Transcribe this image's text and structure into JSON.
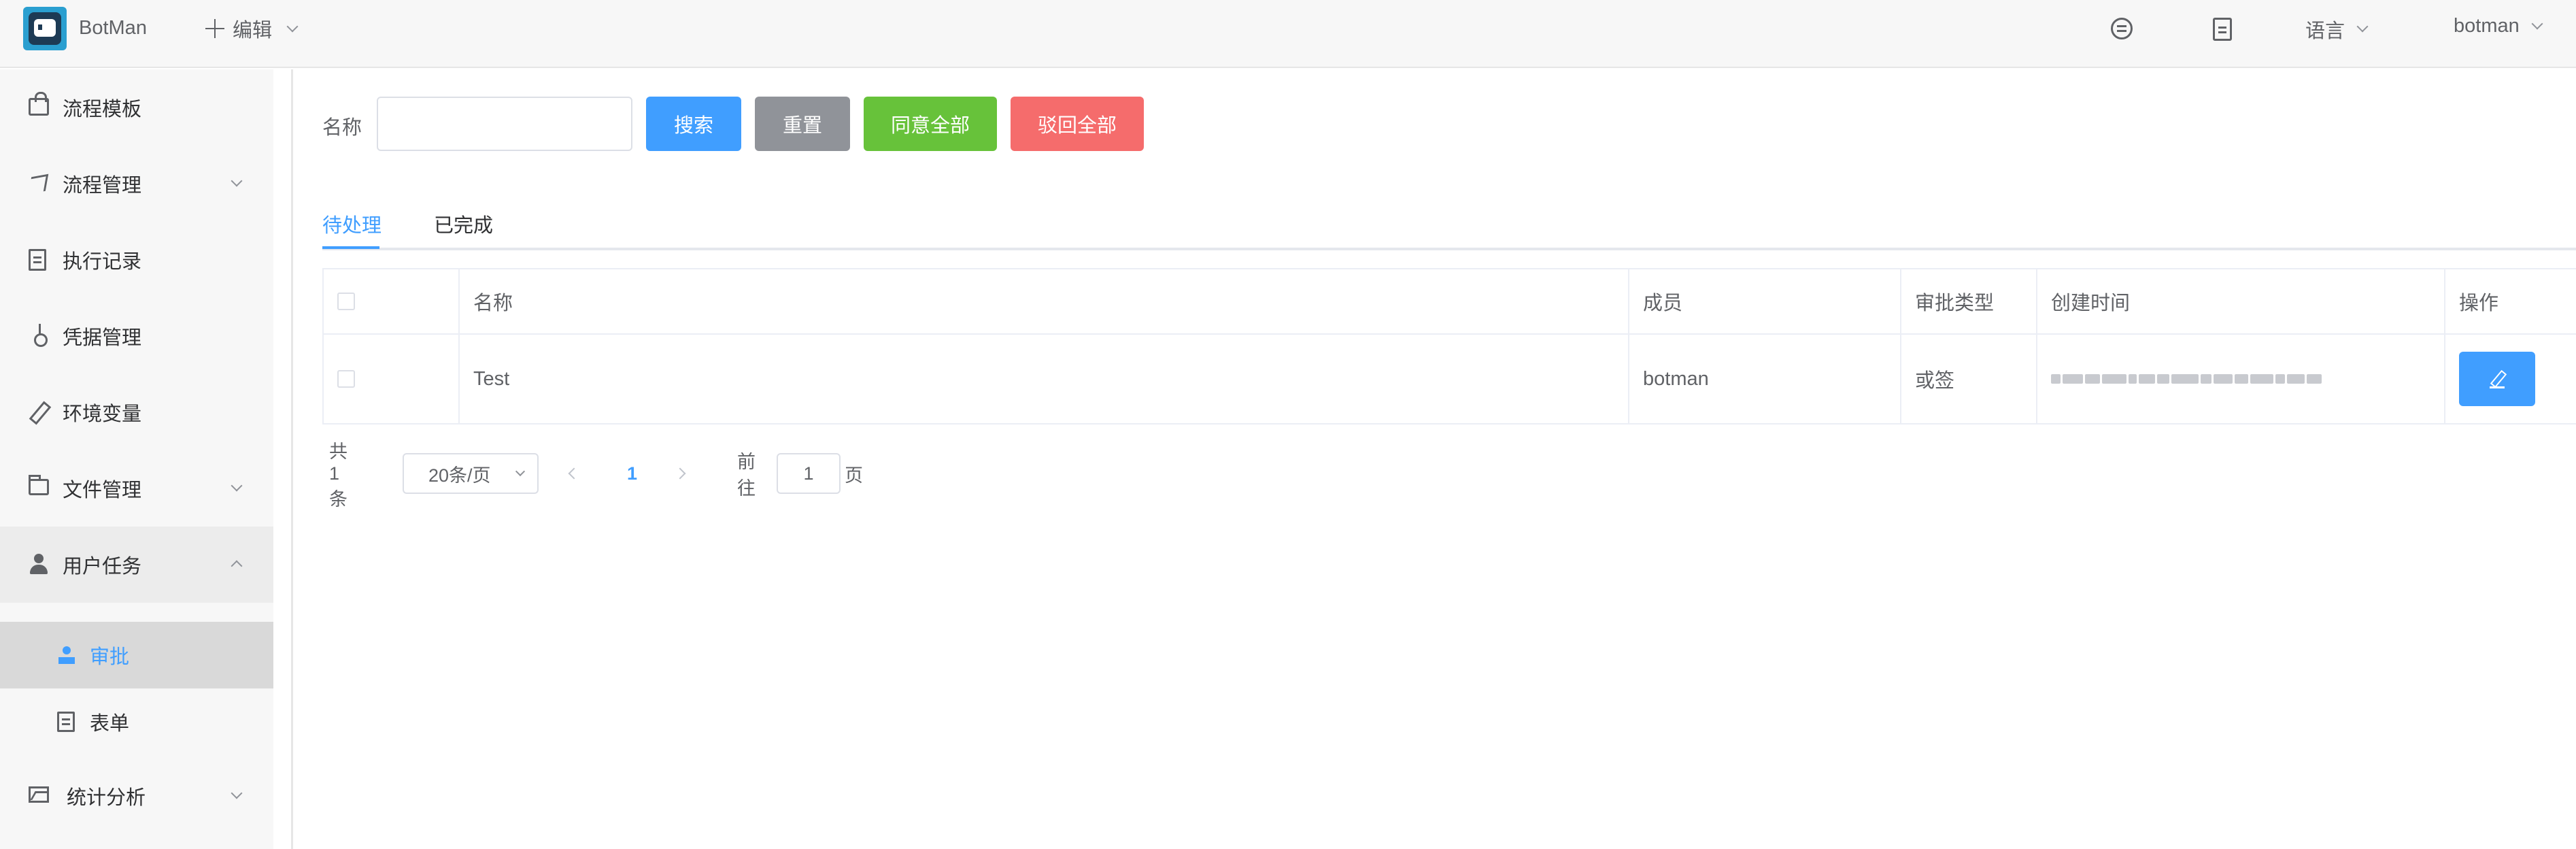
{
  "header": {
    "app_name": "BotMan",
    "edit_menu": "编辑",
    "language_menu": "语言",
    "user_menu": "botman"
  },
  "sidebar": {
    "items": [
      {
        "label": "流程模板",
        "icon": "bag-icon"
      },
      {
        "label": "流程管理",
        "icon": "send-icon",
        "has_children": true
      },
      {
        "label": "执行记录",
        "icon": "list-icon"
      },
      {
        "label": "凭据管理",
        "icon": "key-icon"
      },
      {
        "label": "环境变量",
        "icon": "pen-icon"
      },
      {
        "label": "文件管理",
        "icon": "folder-icon",
        "has_children": true
      },
      {
        "label": "用户任务",
        "icon": "user-icon",
        "expanded": true,
        "children": [
          {
            "label": "审批",
            "icon": "stamp-icon",
            "active": true
          },
          {
            "label": "表单",
            "icon": "form-icon"
          }
        ]
      },
      {
        "label": "统计分析",
        "icon": "chart-icon",
        "has_children": true
      }
    ]
  },
  "filter": {
    "name_label": "名称",
    "name_value": "",
    "search_button": "搜索",
    "reset_button": "重置",
    "approve_all_button": "同意全部",
    "reject_all_button": "驳回全部"
  },
  "tabs": [
    {
      "label": "待处理",
      "active": true
    },
    {
      "label": "已完成",
      "active": false
    }
  ],
  "table": {
    "columns": [
      "名称",
      "成员",
      "审批类型",
      "创建时间",
      "操作"
    ],
    "rows": [
      {
        "name": "Test",
        "member": "botman",
        "type": "或签",
        "created": "(blurred)"
      }
    ]
  },
  "pagination": {
    "total": "共 1 条",
    "page_size": "20条/页",
    "current_page": "1",
    "goto_label": "前往",
    "goto_value": "1",
    "page_unit": "页"
  },
  "colors": {
    "primary": "#409eff",
    "success": "#67c23a",
    "danger": "#f56c6c",
    "info": "#909399"
  }
}
